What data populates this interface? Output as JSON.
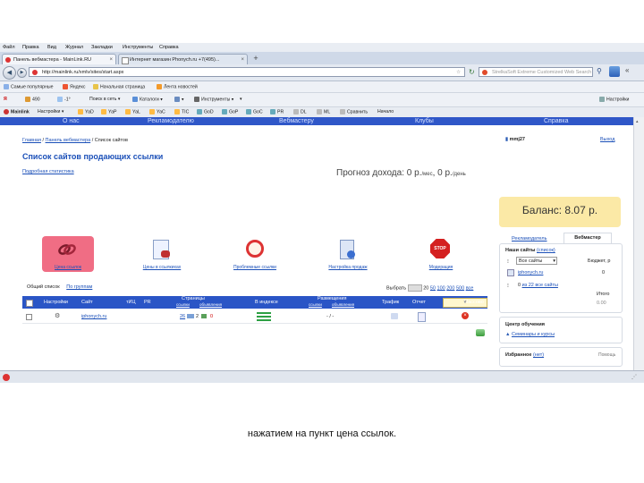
{
  "browser": {
    "menu": [
      "Файл",
      "Правка",
      "Вид",
      "Журнал",
      "Закладки",
      "Инструменты",
      "Справка"
    ],
    "tabs": [
      {
        "label": "Панель вебмастера - MainLink.RU"
      },
      {
        "label": "Интернет магазин Phonych.ru +7(495)..."
      }
    ],
    "new_tab": "+",
    "url": "http://mainlink.ru/xmlv/sites/start.aspx",
    "search_placeholder": "StrelkaSoft Extreme Customized Web Search",
    "bookmarks": [
      "Самые популярные",
      "Яндекс",
      "Начальная страница",
      "Лента новостей"
    ],
    "toolbar2": {
      "counter": "490",
      "weather": "-1°",
      "search_label": "Поиск в сеть",
      "catalog": "Каталоги",
      "tools": "Инструменты",
      "settings": "Настройки"
    },
    "toolbar3": {
      "brand": "Mainlink",
      "settings": "Настройки",
      "items": [
        "YaD",
        "YaP",
        "YaL",
        "YaC",
        "TIC",
        "GoD",
        "GoP",
        "GoC",
        "PR",
        "DL",
        "ML"
      ],
      "compare": "Сравнить",
      "more": "Начало"
    }
  },
  "site": {
    "nav": [
      "О нас",
      "Рекламодателю",
      "Вебмастеру",
      "Клубы",
      "Справка"
    ],
    "breadcrumb": {
      "home": "Главная",
      "panel": "Панель вебмастера",
      "current": "Список сайтов"
    },
    "title": "Список сайтов продающих ссылки",
    "stats_link": "Подробная статистика",
    "forecast": {
      "label": "Прогноз дохода:",
      "month": "0 р.",
      "month_unit": "/мес",
      "sep": ",",
      "day": "0 р.",
      "day_unit": "/день"
    },
    "user": {
      "name": "mmj27",
      "logout": "Выход"
    },
    "balance": "Баланс: 8.07 р.",
    "icons": [
      {
        "label": "Цена ссылок"
      },
      {
        "label": "Цены в ссылкихах"
      },
      {
        "label": "Проблемные ссылки"
      },
      {
        "label": "Настройка продаж"
      },
      {
        "label": "Модерация"
      }
    ],
    "filters": {
      "left": "Общий список",
      "right": "По группам",
      "show": "Выбрать",
      "pager_label": "20",
      "pager": [
        "50",
        "100",
        "200",
        "500"
      ],
      "all": "все"
    },
    "table": {
      "headers": {
        "settings": "Настройки",
        "site": "Сайт",
        "tic": "тИЦ",
        "pr": "PR",
        "pages": "Страницы",
        "pages_sub": "ссылки",
        "pages_sub2": "объявления",
        "yandex": "В индексе",
        "placed": "Размещения",
        "placed_sub": "ссылки",
        "placed_sub2": "объявления",
        "traffic": "Трафик",
        "report": "Отчет",
        "action": "Массово"
      },
      "rows": [
        {
          "site": "iphonych.ru",
          "pages": "26",
          "pages2": "2",
          "pages3": "0",
          "placed": "- / -"
        }
      ]
    },
    "sidebar": {
      "tabs": [
        "Рекламодатель",
        "Вебмастер"
      ],
      "sites_title": "Наши сайты",
      "sites_edit": "(список)",
      "select_value": "Все сайты",
      "budget_label": "Бюджет, р",
      "site_link": "iphonych.ru",
      "site_value": "0",
      "links_count": "0",
      "links_link": "из 22 все сайты",
      "total_label": "Итого",
      "total_value": "0.00",
      "learn_title": "Центр обучения",
      "learn_link": "Семинары и курсы",
      "fav_title": "Избранное",
      "fav_link": "(нет)",
      "fav_help": "Помощь"
    }
  },
  "caption": "нажатием на пункт цена ссылок."
}
